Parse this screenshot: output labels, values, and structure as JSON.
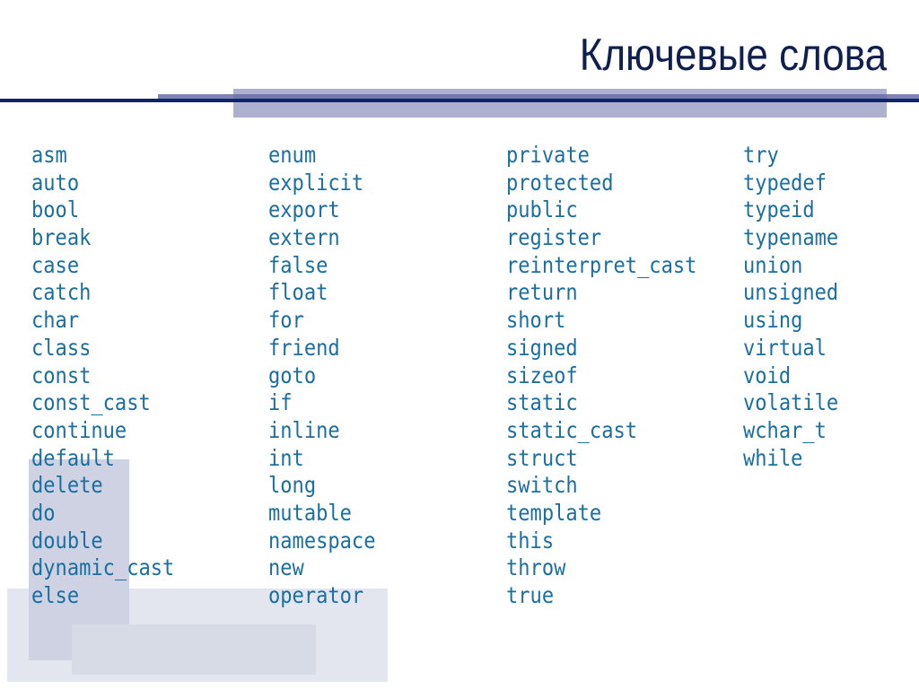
{
  "slide": {
    "title": "Ключевые слова",
    "colors": {
      "title": "#0f1f4f",
      "keyword": "#1a6fa0",
      "rule_dark": "#13236b",
      "rule_mid": "#5a5f97",
      "band_light": "#aeb0d0",
      "deco_tall": "#cfd2e3",
      "deco_wide": "#e4e6ef",
      "deco_inner": "#d7dbe6"
    },
    "columns": [
      [
        "asm",
        "auto",
        "bool",
        "break",
        "case",
        "catch",
        "char",
        "class",
        "const",
        "const_cast",
        "continue",
        "default",
        "delete",
        "do",
        "double",
        "dynamic_cast",
        "else"
      ],
      [
        "enum",
        "explicit",
        "export",
        "extern",
        "false",
        "float",
        "for",
        "friend",
        "goto",
        "if",
        "inline",
        "int",
        "long",
        "mutable",
        "namespace",
        "new",
        "operator"
      ],
      [
        "private",
        "protected",
        "public",
        "register",
        "reinterpret_cast",
        "return",
        "short",
        "signed",
        "sizeof",
        "static",
        "static_cast",
        "struct",
        "switch",
        "template",
        "this",
        "throw",
        "true"
      ],
      [
        "try",
        "typedef",
        "typeid",
        "typename",
        "union",
        "unsigned",
        "using",
        "virtual",
        "void",
        "volatile",
        "wchar_t",
        "while"
      ]
    ]
  }
}
